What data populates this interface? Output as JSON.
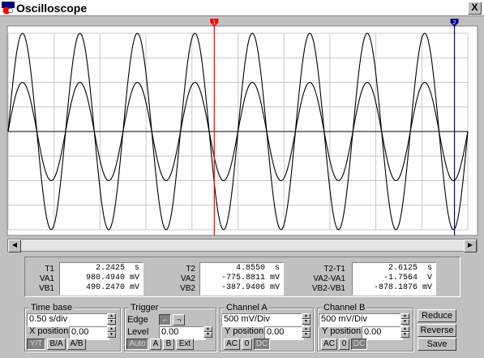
{
  "window": {
    "title": "Oscilloscope",
    "close_label": "X"
  },
  "cursors": {
    "t1_label": "1",
    "t2_label": "2",
    "t1_color": "#ff0000",
    "t2_color": "#000080"
  },
  "chart_data": {
    "type": "line",
    "x_divisions": 10,
    "y_divisions": 8,
    "xlim": [
      0,
      5.0
    ],
    "x_units": "s",
    "ylim": [
      -2.0,
      2.0
    ],
    "y_units": "V",
    "grid": true,
    "series": [
      {
        "amplitude": 2.0,
        "frequency_hz": 1.6,
        "phase_deg": 0,
        "color": "#000000"
      },
      {
        "amplitude": 1.0,
        "frequency_hz": 1.6,
        "phase_deg": 0,
        "color": "#000000"
      }
    ],
    "cursor_t1": 2.2425,
    "cursor_t2": 4.855
  },
  "readout": {
    "col1": {
      "labels": [
        "T1",
        "VA1",
        "VB1"
      ],
      "values": [
        "2.2425  s",
        "980.4940 mV",
        "490.2470 mV"
      ]
    },
    "col2": {
      "labels": [
        "T2",
        "VA2",
        "VB2"
      ],
      "values": [
        "4.8550  s",
        "-775.8811 mV",
        "-387.9406 mV"
      ]
    },
    "col3": {
      "labels": [
        "T2-T1",
        "VA2-VA1",
        "VB2-VB1"
      ],
      "values": [
        "2.6125  s",
        "-1.7564  V",
        "-878.1876 mV"
      ]
    }
  },
  "timebase": {
    "title": "Time base",
    "value": "0.50 s/div",
    "xpos_label": "X position",
    "xpos_value": "0.00",
    "mode_yt": "Y/T",
    "mode_ba": "B/A",
    "mode_ab": "A/B"
  },
  "trigger": {
    "title": "Trigger",
    "edge_label": "Edge",
    "level_label": "Level",
    "level_value": "0.00",
    "btn_auto": "Auto",
    "btn_a": "A",
    "btn_b": "B",
    "btn_ext": "Ext"
  },
  "channel_a": {
    "title": "Channel A",
    "value": "500 mV/Div",
    "ypos_label": "Y position",
    "ypos_value": "0.00",
    "btn_ac": "AC",
    "btn_0": "0",
    "btn_dc": "DC"
  },
  "channel_b": {
    "title": "Channel B",
    "value": "500 mV/Div",
    "ypos_label": "Y position",
    "ypos_value": "0.00",
    "btn_ac": "AC",
    "btn_0": "0",
    "btn_dc": "DC"
  },
  "actions": {
    "reduce": "Reduce",
    "reverse": "Reverse",
    "save": "Save"
  }
}
